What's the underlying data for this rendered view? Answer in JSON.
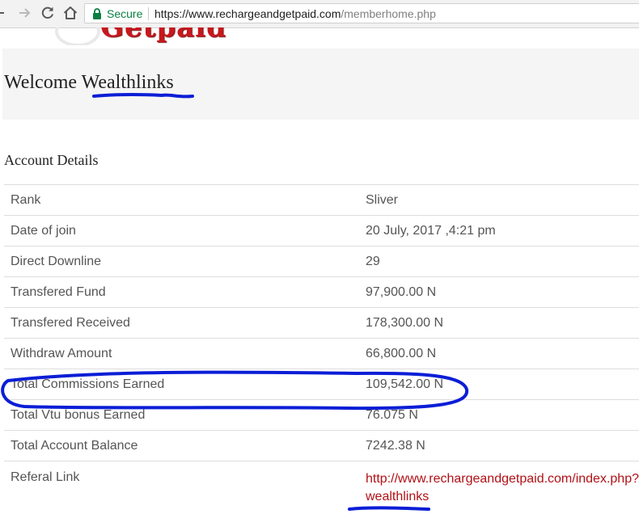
{
  "browser": {
    "security_label": "Secure",
    "url_base": "https://www.rechargeandgetpaid.com",
    "url_path": "/memberhome.php"
  },
  "logo": {
    "text": "Getpaid"
  },
  "welcome": {
    "greeting": "Welcome",
    "username": "Wealthlinks"
  },
  "account": {
    "title": "Account Details",
    "rows": [
      {
        "label": "Rank",
        "value": "Sliver"
      },
      {
        "label": "Date of join",
        "value": "20 July, 2017 ,4:21 pm"
      },
      {
        "label": "Direct Downline",
        "value": "29"
      },
      {
        "label": "Transfered Fund",
        "value": "97,900.00 N"
      },
      {
        "label": "Transfered Received",
        "value": "178,300.00 N"
      },
      {
        "label": "Withdraw Amount",
        "value": "66,800.00 N"
      },
      {
        "label": "Total Commissions Earned",
        "value": "109,542.00 N"
      },
      {
        "label": "Total Vtu bonus Earned",
        "value": "76.075 N"
      },
      {
        "label": "Total Account Balance",
        "value": "7242.38 N"
      },
      {
        "label": "Referal Link",
        "value": "http://www.rechargeandgetpaid.com/index.php?wealthlinks",
        "value_line1": "http://www.rechargeandgetpaid.com/index.php?",
        "value_line2": "wealthlinks"
      }
    ]
  },
  "colors": {
    "brand_red": "#c8171d",
    "link_red": "#b01116",
    "secure_green": "#0b8043",
    "annotation_blue": "#0b1ed6"
  }
}
